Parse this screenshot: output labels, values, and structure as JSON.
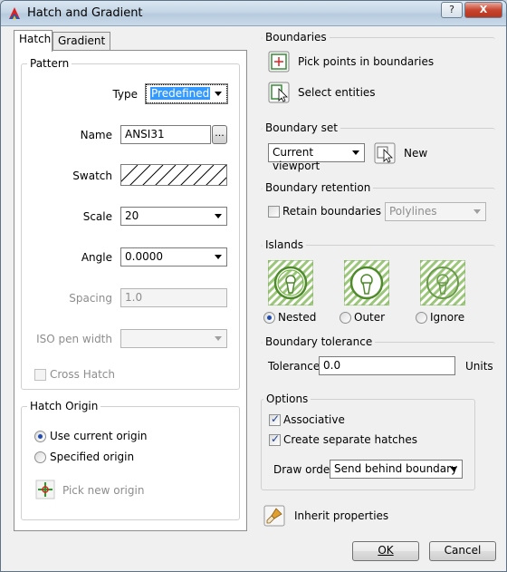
{
  "window": {
    "title": "Hatch and Gradient",
    "help_label": "?",
    "close_label": "X"
  },
  "tabs": [
    {
      "label": "Hatch",
      "active": true
    },
    {
      "label": "Gradient",
      "active": false
    }
  ],
  "pattern": {
    "title": "Pattern",
    "type_label": "Type",
    "type_value": "Predefined",
    "name_label": "Name",
    "name_value": "ANSI31",
    "browse_label": "...",
    "swatch_label": "Swatch",
    "scale_label": "Scale",
    "scale_value": "20",
    "angle_label": "Angle",
    "angle_value": "0.0000",
    "spacing_label": "Spacing",
    "spacing_value": "1.0",
    "iso_label": "ISO pen width",
    "iso_value": "",
    "cross_hatch_label": "Cross Hatch",
    "cross_hatch_checked": false
  },
  "hatch_origin": {
    "title": "Hatch Origin",
    "use_current_label": "Use current origin",
    "specified_label": "Specified origin",
    "pick_new_label": "Pick new origin",
    "selected": "current"
  },
  "boundaries": {
    "title": "Boundaries",
    "pick_points_label": "Pick points in boundaries",
    "select_entities_label": "Select entities"
  },
  "boundary_set": {
    "title": "Boundary set",
    "value": "Current viewport",
    "new_label": "New"
  },
  "boundary_retention": {
    "title": "Boundary retention",
    "retain_label": "Retain boundaries as",
    "retain_checked": false,
    "type_value": "Polylines"
  },
  "islands": {
    "title": "Islands",
    "options": [
      "Nested",
      "Outer",
      "Ignore"
    ],
    "selected": "Nested"
  },
  "boundary_tolerance": {
    "title": "Boundary tolerance",
    "label": "Tolerance",
    "value": "0.0",
    "units": "Units"
  },
  "options": {
    "title": "Options",
    "associative_label": "Associative",
    "associative_checked": true,
    "separate_label": "Create separate hatches",
    "separate_checked": true,
    "draw_order_label": "Draw order",
    "draw_order_value": "Send behind boundary"
  },
  "inherit": {
    "label": "Inherit properties"
  },
  "footer": {
    "ok_label": "OK",
    "cancel_label": "Cancel"
  },
  "colors": {
    "island_green": "#6fb33a",
    "island_hatch": "#9cc77a",
    "accent_blue": "#1f4bb0"
  }
}
